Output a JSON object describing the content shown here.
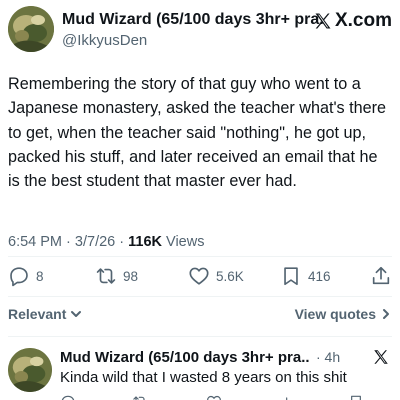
{
  "tweet": {
    "author_name": "Mud Wizard (65/100 days 3hr+ pra...",
    "handle": "@IkkyusDen",
    "brand": "X.com",
    "text": "Remembering the story of that guy who went to a Japanese monastery, asked the teacher what's there to get, when the teacher said \"nothing\", he got up, packed his stuff, and later received an email that he is the best student that master ever had.",
    "time": "6:54 PM",
    "date": "3/7/26",
    "views_count": "116K",
    "views_label": "Views",
    "separator": "·"
  },
  "actions": {
    "replies": "8",
    "reposts": "98",
    "likes": "5.6K",
    "bookmarks": "416",
    "icons": [
      "reply-icon",
      "repost-icon",
      "like-icon",
      "bookmark-icon",
      "share-icon"
    ]
  },
  "filters": {
    "relevant_label": "Relevant",
    "view_quotes_label": "View quotes"
  },
  "reply": {
    "author_name": "Mud Wizard (65/100 days 3hr+ pra...",
    "time": "· 4h",
    "text": "Kinda wild that I wasted 8 years on this shit"
  },
  "colors": {
    "text_primary": "#0f1419",
    "text_secondary": "#536471",
    "divider": "#eff3f4"
  }
}
